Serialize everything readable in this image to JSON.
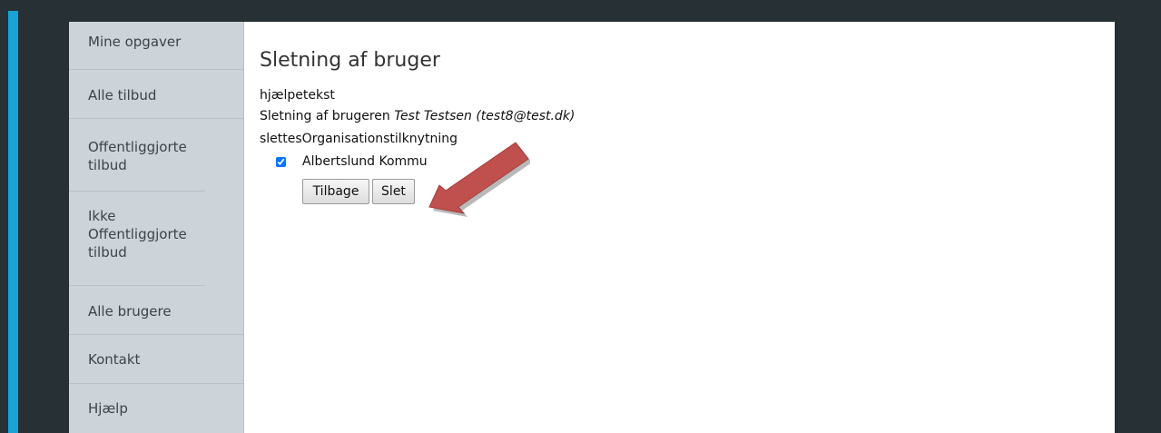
{
  "sidebar": {
    "items": [
      {
        "label": "Mine opgaver"
      },
      {
        "label": "Alle tilbud"
      },
      {
        "label": "Offentliggjorte tilbud"
      },
      {
        "label": "Ikke Offentliggjorte tilbud"
      },
      {
        "label": "Alle brugere"
      },
      {
        "label": "Kontakt"
      },
      {
        "label": "Hjælp"
      }
    ]
  },
  "main": {
    "title": "Sletning af bruger",
    "help_text": "hjælpetekst",
    "description_prefix": "Sletning af brugeren ",
    "user_display": "Test Testsen (test8@test.dk)",
    "org_heading": "slettesOrganisationstilknytning",
    "organization": {
      "label": "Albertslund Kommu",
      "checked": true
    },
    "buttons": {
      "back": "Tilbage",
      "delete": "Slet"
    }
  },
  "annotation": {
    "arrow_color": "#c0504d"
  },
  "theme": {
    "accent": "#1aa2d6",
    "background": "#263035",
    "sidebar": "#ccd3d9"
  }
}
